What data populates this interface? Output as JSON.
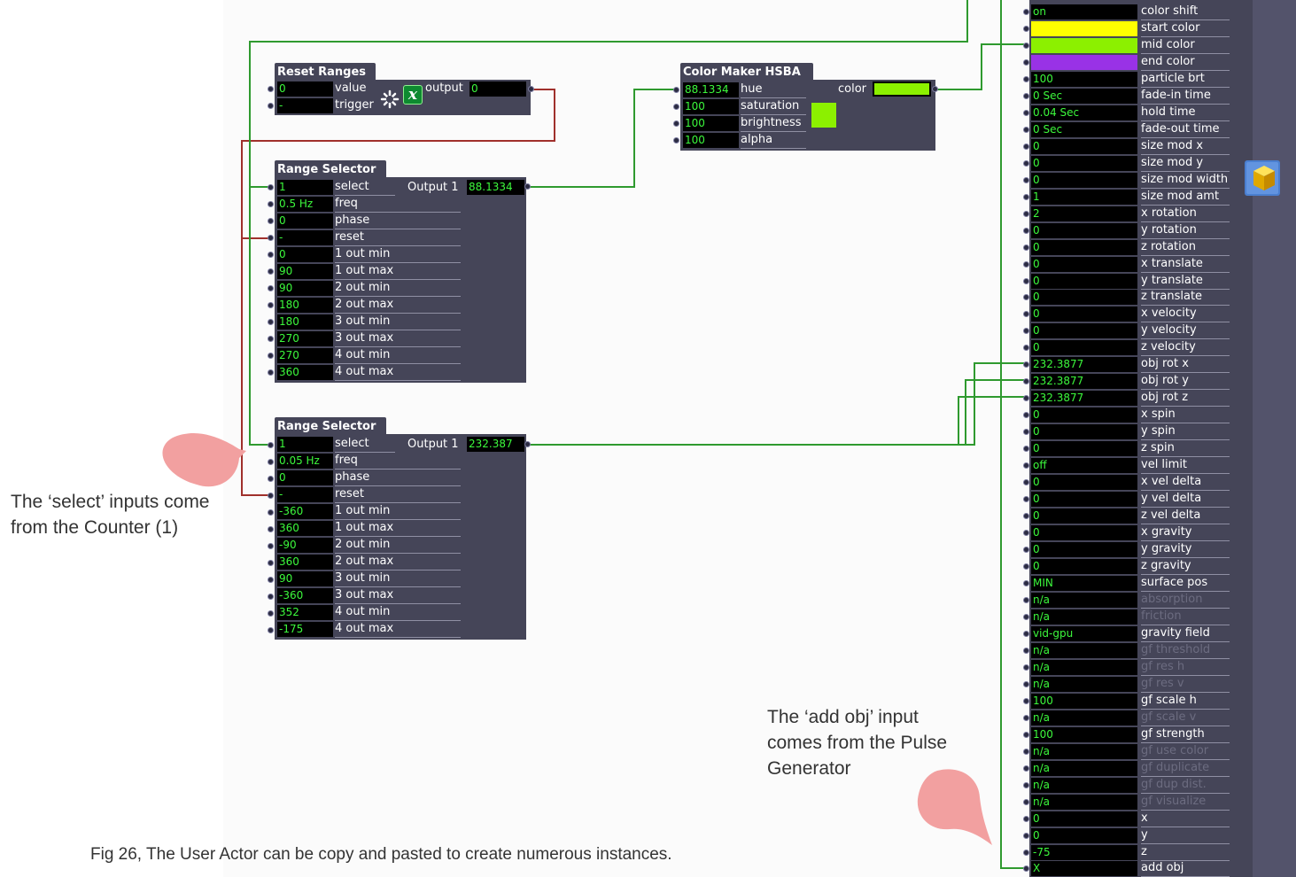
{
  "reset_ranges": {
    "title": "Reset Ranges",
    "value_field": "0",
    "value_label": "value",
    "trigger_field": "-",
    "trigger_label": "trigger",
    "output_label": "output",
    "output_value": "0",
    "math_icon": "x"
  },
  "range_selector_1": {
    "title": "Range Selector",
    "output_label": "Output 1",
    "output_value": "88.1334",
    "rows": [
      {
        "value": "1",
        "label": "select"
      },
      {
        "value": "0.5 Hz",
        "label": "freq"
      },
      {
        "value": "0",
        "label": "phase"
      },
      {
        "value": "-",
        "label": "reset"
      },
      {
        "value": "0",
        "label": "1 out min"
      },
      {
        "value": "90",
        "label": "1 out max"
      },
      {
        "value": "90",
        "label": "2 out min"
      },
      {
        "value": "180",
        "label": "2 out max"
      },
      {
        "value": "180",
        "label": "3 out min"
      },
      {
        "value": "270",
        "label": "3 out max"
      },
      {
        "value": "270",
        "label": "4 out min"
      },
      {
        "value": "360",
        "label": "4 out max"
      }
    ]
  },
  "range_selector_2": {
    "title": "Range Selector",
    "output_label": "Output 1",
    "output_value": "232.387",
    "rows": [
      {
        "value": "1",
        "label": "select"
      },
      {
        "value": "0.05 Hz",
        "label": "freq"
      },
      {
        "value": "0",
        "label": "phase"
      },
      {
        "value": "-",
        "label": "reset"
      },
      {
        "value": "-360",
        "label": "1 out min"
      },
      {
        "value": "360",
        "label": "1 out max"
      },
      {
        "value": "-90",
        "label": "2 out min"
      },
      {
        "value": "360",
        "label": "2 out max"
      },
      {
        "value": "90",
        "label": "3 out min"
      },
      {
        "value": "-360",
        "label": "3 out max"
      },
      {
        "value": "352",
        "label": "4 out min"
      },
      {
        "value": "-175",
        "label": "4 out max"
      }
    ]
  },
  "color_maker": {
    "title": "Color Maker HSBA",
    "output_label": "color",
    "output_color": "#8cf000",
    "swatch_color": "#8cf000",
    "rows": [
      {
        "value": "88.1334",
        "label": "hue"
      },
      {
        "value": "100",
        "label": "saturation"
      },
      {
        "value": "100",
        "label": "brightness"
      },
      {
        "value": "100",
        "label": "alpha"
      }
    ]
  },
  "particle_actor": {
    "color_rows": [
      {
        "label": "start color",
        "color": "#ffff00"
      },
      {
        "label": "mid color",
        "color": "#8cf000"
      },
      {
        "label": "end color",
        "color": "#9932e6"
      }
    ],
    "rows_top": [
      {
        "value": "on",
        "label": "color shift"
      }
    ],
    "rows": [
      {
        "value": "100",
        "label": "particle brt"
      },
      {
        "value": "0 Sec",
        "label": "fade-in time"
      },
      {
        "value": "0.04 Sec",
        "label": "hold time"
      },
      {
        "value": "0 Sec",
        "label": "fade-out time"
      },
      {
        "value": "0",
        "label": "size mod x"
      },
      {
        "value": "0",
        "label": "size mod y"
      },
      {
        "value": "0",
        "label": "size mod width"
      },
      {
        "value": "1",
        "label": "size mod amt"
      },
      {
        "value": "2",
        "label": "x rotation"
      },
      {
        "value": "0",
        "label": "y rotation"
      },
      {
        "value": "0",
        "label": "z rotation"
      },
      {
        "value": "0",
        "label": "x translate"
      },
      {
        "value": "0",
        "label": "y translate"
      },
      {
        "value": "0",
        "label": "z translate"
      },
      {
        "value": "0",
        "label": "x velocity"
      },
      {
        "value": "0",
        "label": "y velocity"
      },
      {
        "value": "0",
        "label": "z velocity"
      },
      {
        "value": "232.3877",
        "label": "obj rot x"
      },
      {
        "value": "232.3877",
        "label": "obj rot y"
      },
      {
        "value": "232.3877",
        "label": "obj rot z"
      },
      {
        "value": "0",
        "label": "x spin"
      },
      {
        "value": "0",
        "label": "y spin"
      },
      {
        "value": "0",
        "label": "z spin"
      },
      {
        "value": "off",
        "label": "vel limit"
      },
      {
        "value": "0",
        "label": "x vel delta"
      },
      {
        "value": "0",
        "label": "y vel delta"
      },
      {
        "value": "0",
        "label": "z vel delta"
      },
      {
        "value": "0",
        "label": "x gravity"
      },
      {
        "value": "0",
        "label": "y gravity"
      },
      {
        "value": "0",
        "label": "z gravity"
      },
      {
        "value": "MIN",
        "label": "surface pos"
      },
      {
        "value": "n/a",
        "label": "absorption"
      },
      {
        "value": "n/a",
        "label": "friction"
      },
      {
        "value": "vid-gpu",
        "label": "gravity field"
      },
      {
        "value": "n/a",
        "label": "gf threshold"
      },
      {
        "value": "n/a",
        "label": "gf res h"
      },
      {
        "value": "n/a",
        "label": "gf res v"
      },
      {
        "value": "100",
        "label": "gf scale h"
      },
      {
        "value": "n/a",
        "label": "gf scale v"
      },
      {
        "value": "100",
        "label": "gf strength"
      },
      {
        "value": "n/a",
        "label": "gf use color"
      },
      {
        "value": "n/a",
        "label": "gf duplicate"
      },
      {
        "value": "n/a",
        "label": "gf dup dist."
      },
      {
        "value": "n/a",
        "label": "gf visualize"
      },
      {
        "value": "0",
        "label": "x"
      },
      {
        "value": "0",
        "label": "y"
      },
      {
        "value": "-75",
        "label": "z"
      },
      {
        "value": "X",
        "label": "add obj"
      }
    ]
  },
  "annotations": {
    "select_note": "The ‘select’ inputs come from the Counter (1)",
    "select_note_line1": "The ‘select’ inputs come",
    "select_note_line2": "from the Counter (1)",
    "add_obj_note_line1": "The ‘add obj’ input",
    "add_obj_note_line2": "comes from the Pulse",
    "add_obj_note_line3": "Generator",
    "figure_caption": "Fig 26, The User Actor can be copy and pasted to create numerous instances."
  },
  "colors": {
    "actor_bg": "#454558",
    "field_text": "#3cf83c",
    "wire_green": "#2f9a2f",
    "wire_red": "#a0302c",
    "bubble": "#f2a0a0"
  }
}
